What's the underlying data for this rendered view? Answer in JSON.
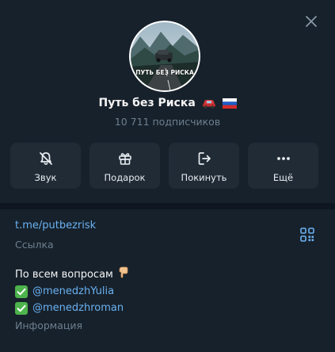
{
  "header": {
    "close_icon": "close-icon"
  },
  "channel": {
    "title": "Путь без Риска",
    "title_emojis": [
      "car-emoji",
      "russian-flag-emoji"
    ],
    "subscribers": "10 711 подписчиков",
    "avatar_text": "ПУТЬ БЕЗ РИСКА"
  },
  "actions": [
    {
      "label": "Звук",
      "icon": "bell-off-icon"
    },
    {
      "label": "Подарок",
      "icon": "gift-icon"
    },
    {
      "label": "Покинуть",
      "icon": "leave-icon"
    },
    {
      "label": "Ещё",
      "icon": "more-icon"
    }
  ],
  "info": {
    "link": "t.me/putbezrisk",
    "link_label": "Ссылка",
    "qr_icon": "qr-code-icon",
    "description_intro": "По всем вопросам",
    "contacts": [
      "@menedzhYulia",
      "@menedzhroman"
    ],
    "description_label": "Информация"
  },
  "colors": {
    "background": "#17212b",
    "button_bg": "#202b36",
    "accent": "#6ab2f2",
    "muted": "#6d7f8f",
    "check_green": "#4db34d"
  }
}
